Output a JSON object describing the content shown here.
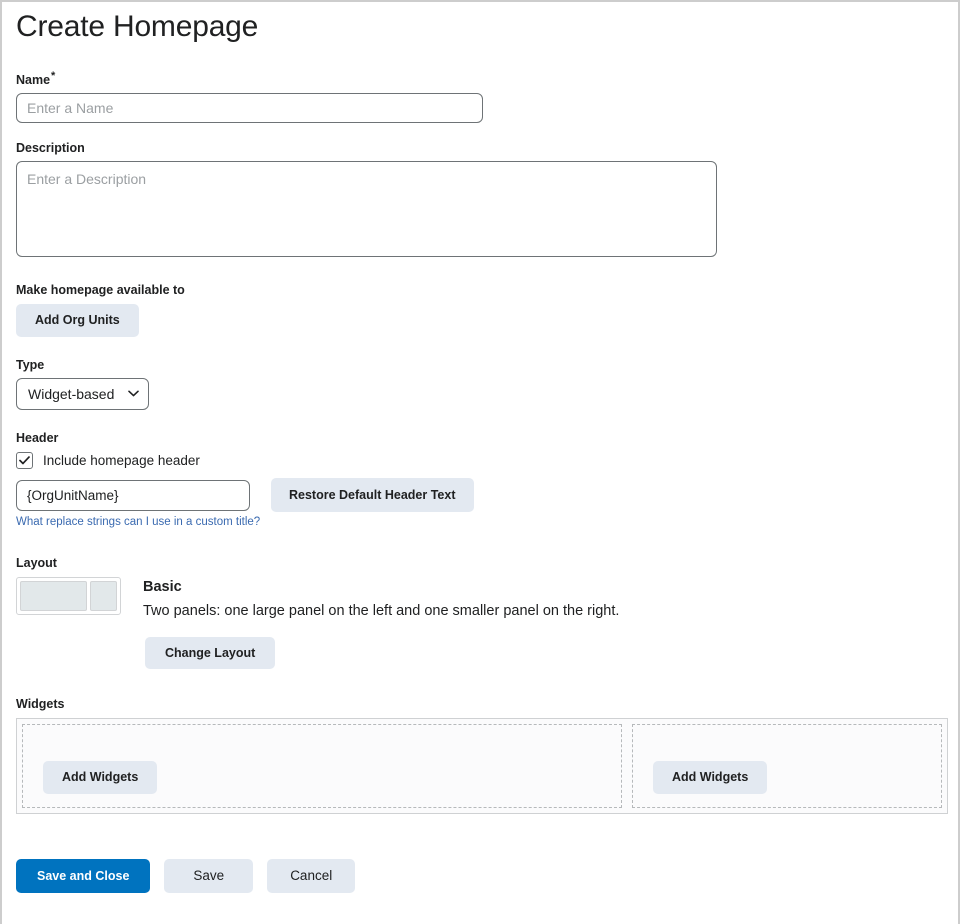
{
  "page": {
    "title": "Create Homepage"
  },
  "name_field": {
    "label": "Name",
    "required_marker": "*",
    "placeholder": "Enter a Name",
    "value": ""
  },
  "description_field": {
    "label": "Description",
    "placeholder": "Enter a Description",
    "value": ""
  },
  "availability": {
    "label": "Make homepage available to",
    "add_org_units_label": "Add Org Units"
  },
  "type_field": {
    "label": "Type",
    "selected": "Widget-based",
    "options": [
      "Widget-based"
    ],
    "chevron_icon": "chevron-down-icon"
  },
  "header_section": {
    "label": "Header",
    "include_checkbox_label": "Include homepage header",
    "include_checkbox_checked": true,
    "check_icon": "check-icon",
    "title_value": "{OrgUnitName}",
    "restore_button_label": "Restore Default Header Text",
    "help_link_text": "What replace strings can I use in a custom title?"
  },
  "layout_section": {
    "label": "Layout",
    "thumbnail_icon": "two-panel-layout-icon",
    "name": "Basic",
    "description": "Two panels: one large panel on the left and one smaller panel on the right.",
    "change_layout_label": "Change Layout"
  },
  "widgets_section": {
    "label": "Widgets",
    "panels": [
      {
        "add_label": "Add Widgets"
      },
      {
        "add_label": "Add Widgets"
      }
    ]
  },
  "footer": {
    "save_and_close_label": "Save and Close",
    "save_label": "Save",
    "cancel_label": "Cancel"
  },
  "colors": {
    "primary_button": "#0073bf",
    "secondary_button": "#e3e9f1",
    "link": "#3a6ab0",
    "text": "#202122",
    "input_border": "#6e7376",
    "panel_fill": "#e2e8ea"
  }
}
